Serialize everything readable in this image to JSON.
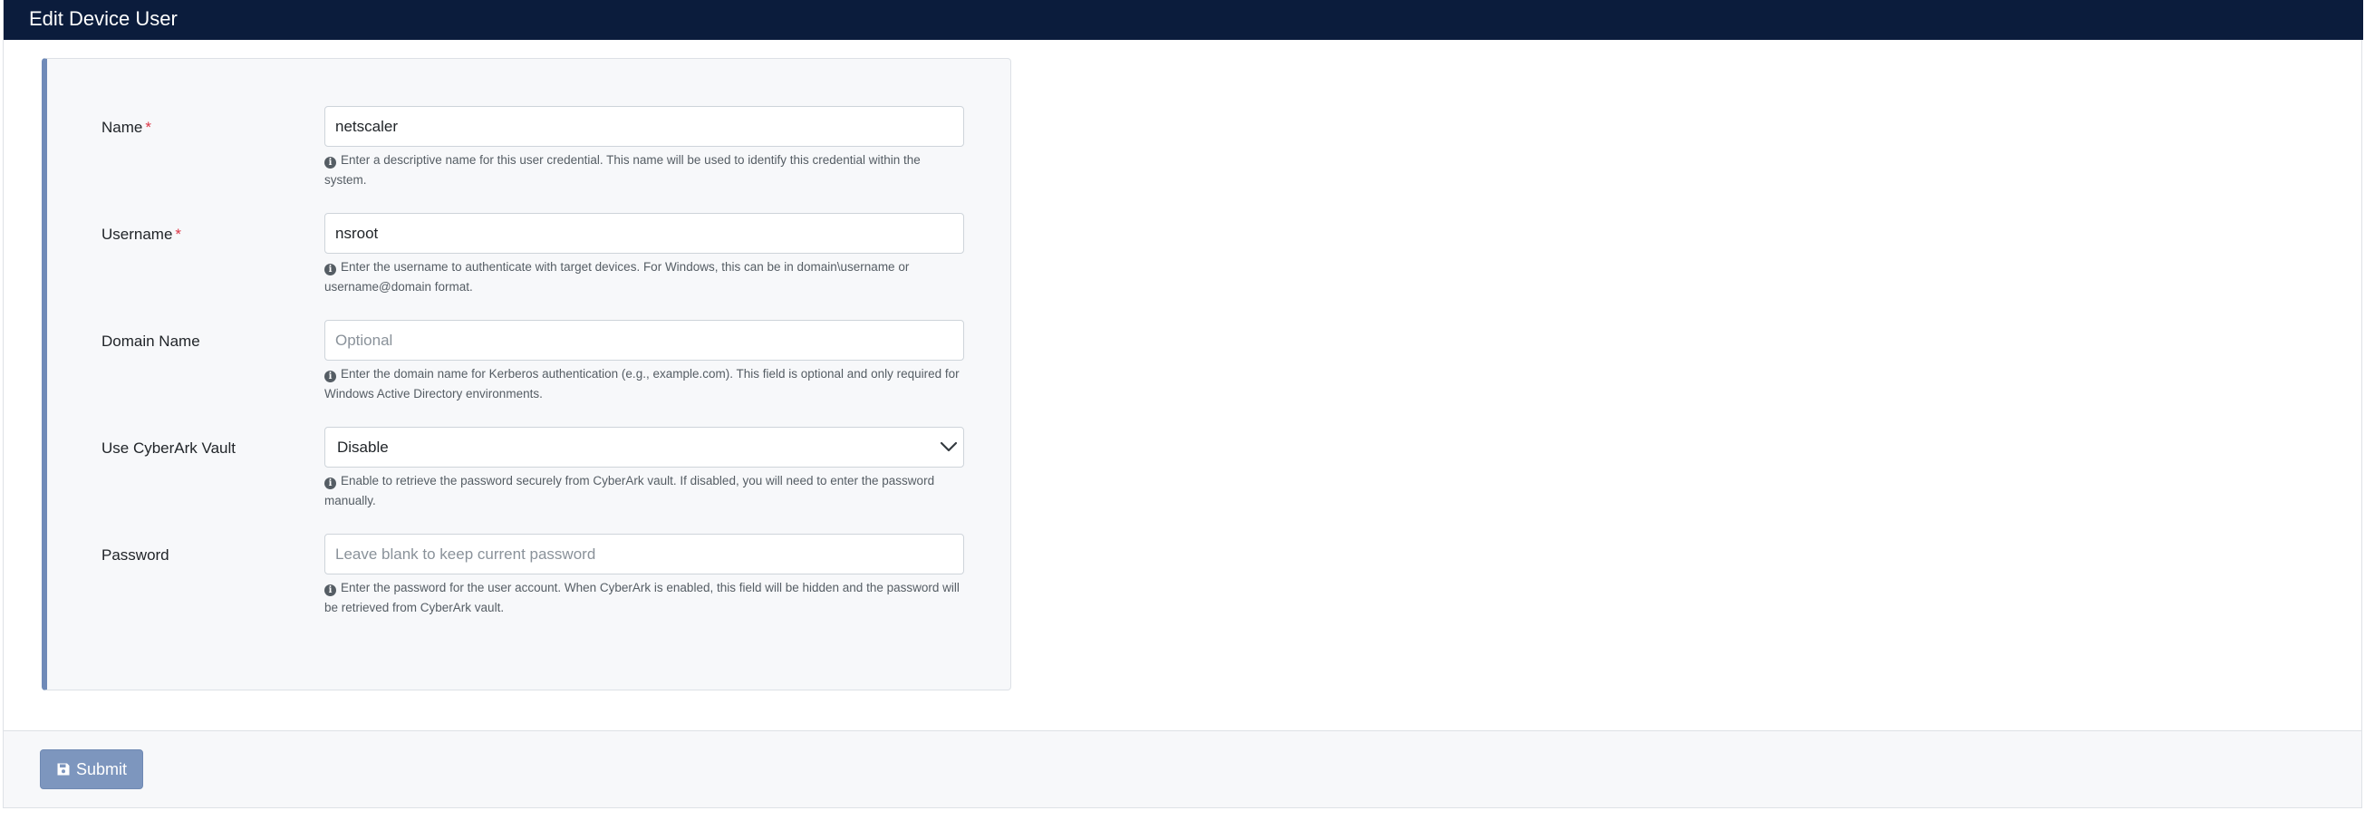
{
  "header": {
    "title": "Edit Device User"
  },
  "form": {
    "name": {
      "label": "Name",
      "required": "*",
      "value": "netscaler",
      "help": "Enter a descriptive name for this user credential. This name will be used to identify this credential within the system."
    },
    "username": {
      "label": "Username",
      "required": "*",
      "value": "nsroot",
      "help": "Enter the username to authenticate with target devices. For Windows, this can be in domain\\username or username@domain format."
    },
    "domain": {
      "label": "Domain Name",
      "value": "",
      "placeholder": "Optional",
      "help": "Enter the domain name for Kerberos authentication (e.g., example.com). This field is optional and only required for Windows Active Directory environments."
    },
    "cyberark": {
      "label": "Use CyberArk Vault",
      "selected": "Disable",
      "help": "Enable to retrieve the password securely from CyberArk vault. If disabled, you will need to enter the password manually."
    },
    "password": {
      "label": "Password",
      "value": "",
      "placeholder": "Leave blank to keep current password",
      "help": "Enter the password for the user account. When CyberArk is enabled, this field will be hidden and the password will be retrieved from CyberArk vault."
    }
  },
  "footer": {
    "submit_label": "Submit"
  },
  "icons": {
    "info": "info-circle-icon",
    "save": "floppy-disk-icon",
    "chevron": "chevron-down-icon"
  },
  "colors": {
    "header_bg": "#0b1c3c",
    "accent": "#6f8ab8",
    "required": "#dc3545",
    "submit_bg": "#7d96be"
  }
}
